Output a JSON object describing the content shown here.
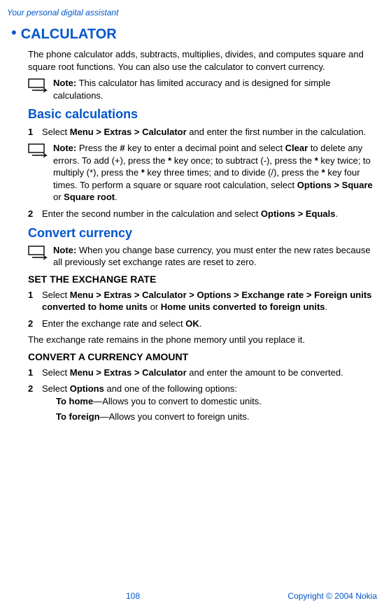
{
  "header": "Your personal digital assistant",
  "h1": "CALCULATOR",
  "intro": "The phone calculator adds, subtracts, multiplies, divides, and computes square and square root functions. You can also use the calculator to convert currency.",
  "note1_label": "Note:",
  "note1": " This calculator has limited accuracy and is designed for simple calculations.",
  "h2_basic": "Basic calculations",
  "step_b1_pre": "Select ",
  "step_b1_bold": "Menu > Extras > Calculator",
  "step_b1_post": " and enter the first number in the calculation.",
  "note2_label": "Note:",
  "note2_a": " Press the ",
  "note2_hash": "#",
  "note2_b": " key to enter a decimal point and select ",
  "note2_clear": "Clear",
  "note2_c": " to delete any errors. To add (+), press the ",
  "note2_star1": "*",
  "note2_d": " key once; to subtract (-), press the ",
  "note2_star2": "*",
  "note2_e": " key twice; to multiply (*), press the ",
  "note2_star3": "*",
  "note2_f": " key three times; and to divide (/), press the ",
  "note2_star4": "*",
  "note2_g": " key four times. To perform a square or square root calculation, select ",
  "note2_opt": "Options > Square",
  "note2_or": " or ",
  "note2_sqroot": "Square root",
  "note2_end": ".",
  "step_b2_pre": "Enter the second number in the calculation and select ",
  "step_b2_bold": "Options > Equals",
  "step_b2_post": ".",
  "h2_convert": "Convert currency",
  "note3_label": "Note:",
  "note3": " When you change base currency, you must enter the new rates because all previously set exchange rates are reset to zero.",
  "h3_rate": "SET THE EXCHANGE RATE",
  "step_r1_pre": "Select ",
  "step_r1_bold1": "Menu > Extras > Calculator > Options > Exchange rate > Foreign units converted to home units",
  "step_r1_or": " or ",
  "step_r1_bold2": "Home units converted to foreign units",
  "step_r1_post": ".",
  "step_r2_pre": "Enter the exchange rate and select ",
  "step_r2_bold": "OK",
  "step_r2_post": ".",
  "rate_footer": "The exchange rate remains in the phone memory until you replace it.",
  "h3_amount": "CONVERT A CURRENCY AMOUNT",
  "step_a1_pre": "Select ",
  "step_a1_bold": "Menu > Extras > Calculator",
  "step_a1_post": " and enter the amount to be converted.",
  "step_a2_pre": "Select ",
  "step_a2_bold": "Options",
  "step_a2_post": " and one of the following options:",
  "opt_home_b": "To home",
  "opt_home_t": "—Allows you to convert to domestic units.",
  "opt_foreign_b": "To foreign",
  "opt_foreign_t": "—Allows you convert to foreign units.",
  "page_num": "108",
  "copyright": "Copyright © 2004 Nokia",
  "num1": "1",
  "num2": "2"
}
